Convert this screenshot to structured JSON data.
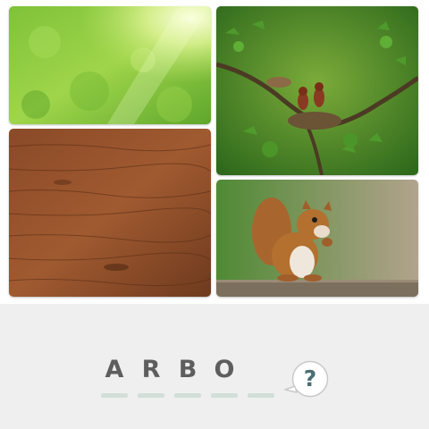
{
  "puzzle": {
    "images": [
      {
        "name": "sunlit-foliage"
      },
      {
        "name": "birds-nest"
      },
      {
        "name": "wood-planks"
      },
      {
        "name": "squirrel"
      }
    ],
    "answer_slots": [
      {
        "letter": "A"
      },
      {
        "letter": "R"
      },
      {
        "letter": "B"
      },
      {
        "letter": "O"
      },
      {
        "letter": ""
      }
    ],
    "hint": {
      "symbol": "?"
    }
  },
  "colors": {
    "slot_dash": "#d2dfd9",
    "letter": "#5e5e5e",
    "hint_mark": "#4a6e73"
  }
}
